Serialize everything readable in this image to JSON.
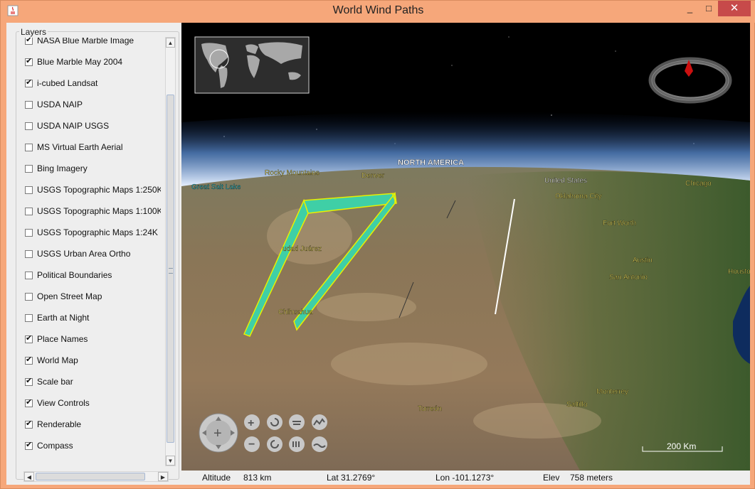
{
  "window": {
    "title": "World Wind Paths"
  },
  "window_controls": {
    "minimize": "_",
    "maximize": "□",
    "close": "✕"
  },
  "layers": {
    "title": "Layers",
    "items": [
      {
        "label": "NASA Blue Marble Image",
        "checked": true
      },
      {
        "label": "Blue Marble May 2004",
        "checked": true
      },
      {
        "label": "i-cubed Landsat",
        "checked": true
      },
      {
        "label": "USDA NAIP",
        "checked": false
      },
      {
        "label": "USDA NAIP USGS",
        "checked": false
      },
      {
        "label": "MS Virtual Earth Aerial",
        "checked": false
      },
      {
        "label": "Bing Imagery",
        "checked": false
      },
      {
        "label": "USGS Topographic Maps 1:250K",
        "checked": false
      },
      {
        "label": "USGS Topographic Maps 1:100K",
        "checked": false
      },
      {
        "label": "USGS Topographic Maps 1:24K",
        "checked": false
      },
      {
        "label": "USGS Urban Area Ortho",
        "checked": false
      },
      {
        "label": "Political Boundaries",
        "checked": false
      },
      {
        "label": "Open Street Map",
        "checked": false
      },
      {
        "label": "Earth at Night",
        "checked": false
      },
      {
        "label": "Place Names",
        "checked": true
      },
      {
        "label": "World Map",
        "checked": true
      },
      {
        "label": "Scale bar",
        "checked": true
      },
      {
        "label": "View Controls",
        "checked": true
      },
      {
        "label": "Renderable",
        "checked": true
      },
      {
        "label": "Compass",
        "checked": true
      }
    ]
  },
  "map": {
    "places": {
      "north_america": "NORTH AMERICA",
      "rocky_mountains": "Rocky Mountains",
      "denver": "Denver",
      "great_salt_lake": "Great Salt Lake",
      "united_states": "United States",
      "oklahoma_city": "Oklahoma City",
      "chicago": "Chicago",
      "fort_worth": "Fort Worth",
      "austin": "Austin",
      "houston": "Housto",
      "san_antonio": "San Antonio",
      "ciudad_juarez": "udad Juárez",
      "chihuahua": "Chihuahua",
      "monterrey": "Monterrey",
      "saltillo": "Saltillo",
      "torreon": "Torreón"
    },
    "scale_bar": "200 Km",
    "colors": {
      "path_fill": "#3fcfa6",
      "path_outline": "#e8f000",
      "place_label": "#f0e060",
      "lake_label": "#30d0e0"
    }
  },
  "status": {
    "altitude_label": "Altitude",
    "altitude_value": "813 km",
    "lat": "Lat 31.2769°",
    "lon": "Lon -101.1273°",
    "elev_label": "Elev",
    "elev_value": "758 meters"
  }
}
